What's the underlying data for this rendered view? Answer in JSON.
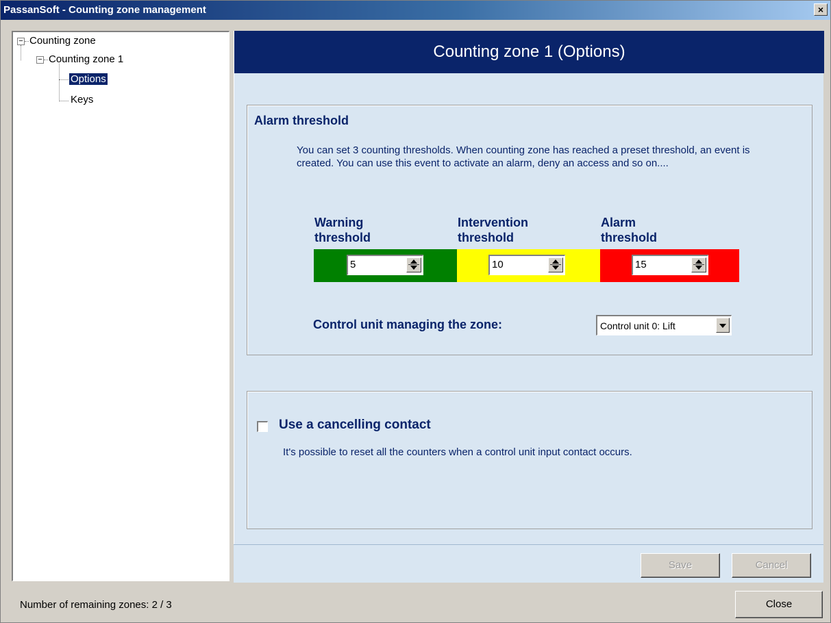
{
  "window": {
    "title": "PassanSoft - Counting zone management",
    "close_glyph": "×"
  },
  "tree": {
    "root": "Counting zone",
    "child": "Counting zone 1",
    "items": [
      "Options",
      "Keys"
    ],
    "selected": "Options"
  },
  "panel": {
    "header": "Counting zone 1 (Options)",
    "alarm_group": {
      "title": "Alarm threshold",
      "description": "You can set 3 counting thresholds. When counting zone has reached a preset threshold, an event is created. You can use this event to activate an alarm, deny an access and so on....",
      "thresholds": [
        {
          "label_line1": "Warning",
          "label_line2": "threshold",
          "value": "5",
          "color": "#008000"
        },
        {
          "label_line1": "Intervention",
          "label_line2": "threshold",
          "value": "10",
          "color": "#ffff00"
        },
        {
          "label_line1": "Alarm",
          "label_line2": "threshold",
          "value": "15",
          "color": "#ff0000"
        }
      ],
      "control_label": "Control unit managing the zone:",
      "control_value": "Control unit 0: Lift"
    },
    "cancel_group": {
      "checkbox_label": "Use a cancelling contact",
      "checked": false,
      "description": "It's possible to reset all the counters when a control unit input contact occurs."
    },
    "buttons": {
      "save": "Save",
      "cancel": "Cancel"
    }
  },
  "footer": {
    "status": "Number of remaining zones: 2 / 3",
    "close": "Close"
  },
  "colors": {
    "accent": "#0a246a",
    "panel_bg": "#d9e6f2",
    "dialog_bg": "#d4d0c8"
  }
}
